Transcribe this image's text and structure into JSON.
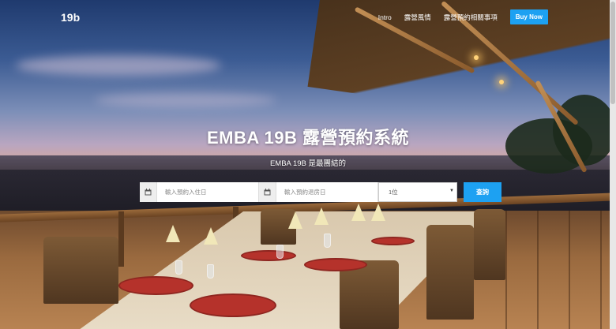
{
  "navbar": {
    "brand": "19b",
    "links": [
      "Intro",
      "露營風情",
      "露營預約相關事項"
    ],
    "buy_label": "Buy Now"
  },
  "hero": {
    "title": "EMBA 19B 露營預約系統",
    "subtitle": "EMBA 19B 是最團結的"
  },
  "booking": {
    "checkin_placeholder": "輸入預約入住日",
    "checkout_placeholder": "輸入預約退房日",
    "guests_selected": "1位",
    "submit_label": "查詢",
    "checkin_icon": "calendar-icon",
    "checkout_icon": "calendar-icon"
  },
  "colors": {
    "accent": "#1da1f2",
    "text": "#ffffff"
  }
}
